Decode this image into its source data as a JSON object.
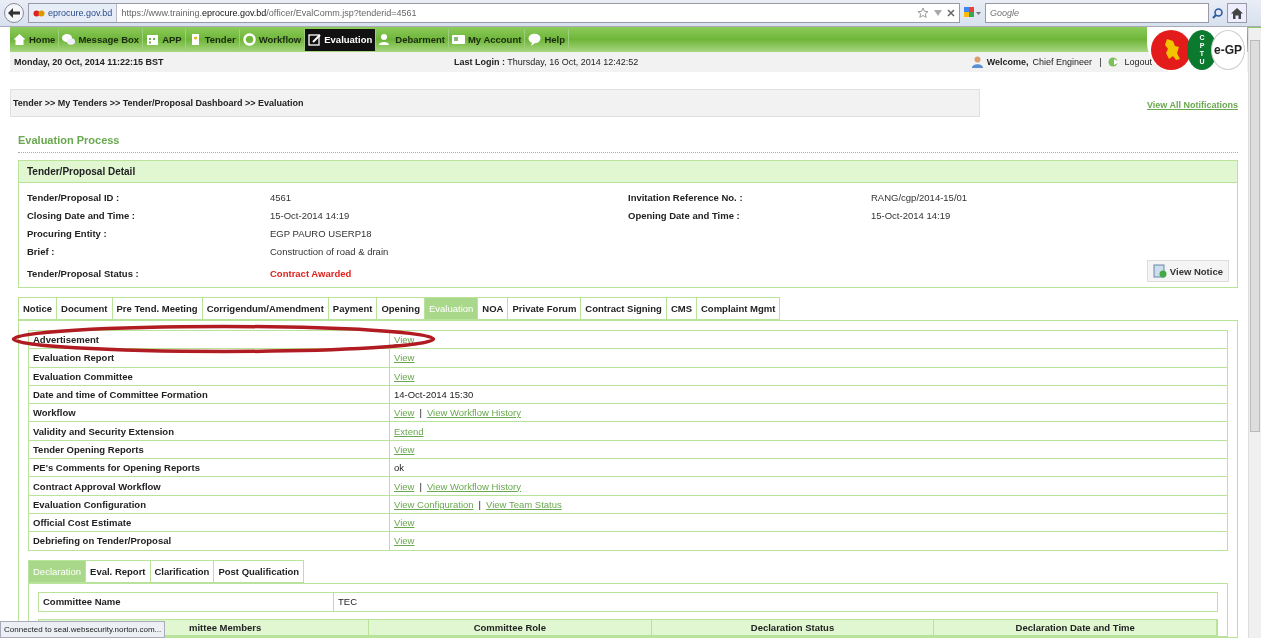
{
  "browser": {
    "site_badge": "eprocure.gov.bd",
    "url": "https://www.training.**eprocure.gov.bd**/officer/EvalComm.jsp?tenderid=4561",
    "search_placeholder": "Google"
  },
  "nav": [
    {
      "label": "Home",
      "kind": "home",
      "selected": false
    },
    {
      "label": "Message Box",
      "kind": "chat",
      "selected": false
    },
    {
      "label": "APP",
      "kind": "calendar",
      "selected": false
    },
    {
      "label": "Tender",
      "kind": "doc",
      "selected": false
    },
    {
      "label": "Workflow",
      "kind": "cycle",
      "selected": false
    },
    {
      "label": "Evaluation",
      "kind": "edit",
      "selected": true
    },
    {
      "label": "Debarment",
      "kind": "user",
      "selected": false
    },
    {
      "label": "My Account",
      "kind": "card",
      "selected": false
    },
    {
      "label": "Help",
      "kind": "help",
      "selected": false
    }
  ],
  "info": {
    "date": "Monday, 20 Oct, 2014 11:22:15 BST",
    "last_login_label": "Last Login :",
    "last_login_value": "Thursday, 16 Oct, 2014 12:42:52",
    "welcome_label": "Welcome,",
    "user": "Chief Engineer",
    "separator": "|",
    "logout": "Logout"
  },
  "logo": {
    "letters": [
      "C",
      "P",
      "T",
      "U"
    ],
    "text": "e-GP"
  },
  "breadcrumb": "Tender >> My Tenders >> Tender/Proposal Dashboard >> Evaluation",
  "notifications_link": "View All Notifications",
  "section_title": "Evaluation Process",
  "detail": {
    "title": "Tender/Proposal Detail",
    "left": [
      {
        "label": "Tender/Proposal ID :",
        "value": "4561",
        "kind": "text"
      },
      {
        "label": "Closing Date and Time :",
        "value": "15-Oct-2014 14:19",
        "kind": "text"
      },
      {
        "label": "Procuring Entity :",
        "value": "EGP PAURO USERP18",
        "kind": "text"
      },
      {
        "label": "Brief :",
        "value": "Construction of road & drain",
        "kind": "text"
      },
      {
        "label": "Tender/Proposal Status :",
        "value": "Contract Awarded",
        "kind": "status"
      }
    ],
    "right": [
      {
        "label": "Invitation Reference No. :",
        "value": "RANG/cgp/2014-15/01",
        "kind": "text"
      },
      {
        "label": "Opening Date and Time :",
        "value": "15-Oct-2014 14:19",
        "kind": "text"
      }
    ],
    "button": "View Notice"
  },
  "tabs": [
    {
      "label": "Notice",
      "selected": false
    },
    {
      "label": "Document",
      "selected": false
    },
    {
      "label": "Pre Tend. Meeting",
      "selected": false
    },
    {
      "label": "Corrigendum/Amendment",
      "selected": false
    },
    {
      "label": "Payment",
      "selected": false
    },
    {
      "label": "Opening",
      "selected": false
    },
    {
      "label": "Evaluation",
      "selected": true
    },
    {
      "label": "NOA",
      "selected": false
    },
    {
      "label": "Private Forum",
      "selected": false
    },
    {
      "label": "Contract Signing",
      "selected": false
    },
    {
      "label": "CMS",
      "selected": false
    },
    {
      "label": "Complaint Mgmt",
      "selected": false
    }
  ],
  "rows": [
    {
      "label": "Advertisement",
      "kind": "links",
      "links": [
        "View"
      ],
      "highlighted": true
    },
    {
      "label": "Evaluation Report",
      "kind": "links",
      "links": [
        "View"
      ],
      "highlighted": false
    },
    {
      "label": "Evaluation Committee",
      "kind": "links",
      "links": [
        "View"
      ],
      "highlighted": false
    },
    {
      "label": "Date and time of Committee Formation",
      "kind": "text",
      "value": "14-Oct-2014 15:30",
      "highlighted": false
    },
    {
      "label": "Workflow",
      "kind": "links",
      "links": [
        "View",
        "View Workflow History"
      ],
      "highlighted": false
    },
    {
      "label": "Validity and Security Extension",
      "kind": "links",
      "links": [
        "Extend"
      ],
      "highlighted": false
    },
    {
      "label": "Tender Opening Reports",
      "kind": "links",
      "links": [
        "View"
      ],
      "highlighted": false
    },
    {
      "label": "PE's Comments for Opening Reports",
      "kind": "text",
      "value": "ok",
      "highlighted": false
    },
    {
      "label": "Contract Approval Workflow",
      "kind": "links",
      "links": [
        "View",
        "View Workflow History"
      ],
      "highlighted": false
    },
    {
      "label": "Evaluation Configuration",
      "kind": "links",
      "links": [
        "View Configuration",
        "View Team Status"
      ],
      "highlighted": false
    },
    {
      "label": "Official Cost Estimate",
      "kind": "links",
      "links": [
        "View"
      ],
      "highlighted": false
    },
    {
      "label": "Debriefing on Tender/Proposal",
      "kind": "links",
      "links": [
        "View"
      ],
      "highlighted": false
    }
  ],
  "link_separator": "|",
  "subtabs": [
    {
      "label": "Declaration",
      "selected": true
    },
    {
      "label": "Eval. Report",
      "selected": false
    },
    {
      "label": "Clarification",
      "selected": false
    },
    {
      "label": "Post Qualification",
      "selected": false
    }
  ],
  "committee": {
    "label": "Committee Name",
    "value": "TEC"
  },
  "members_columns": [
    "mittee Members",
    "Committee Role",
    "Declaration Status",
    "Declaration Date and Time"
  ],
  "status_bar": "Connected to seal.websecurity.norton.com..."
}
